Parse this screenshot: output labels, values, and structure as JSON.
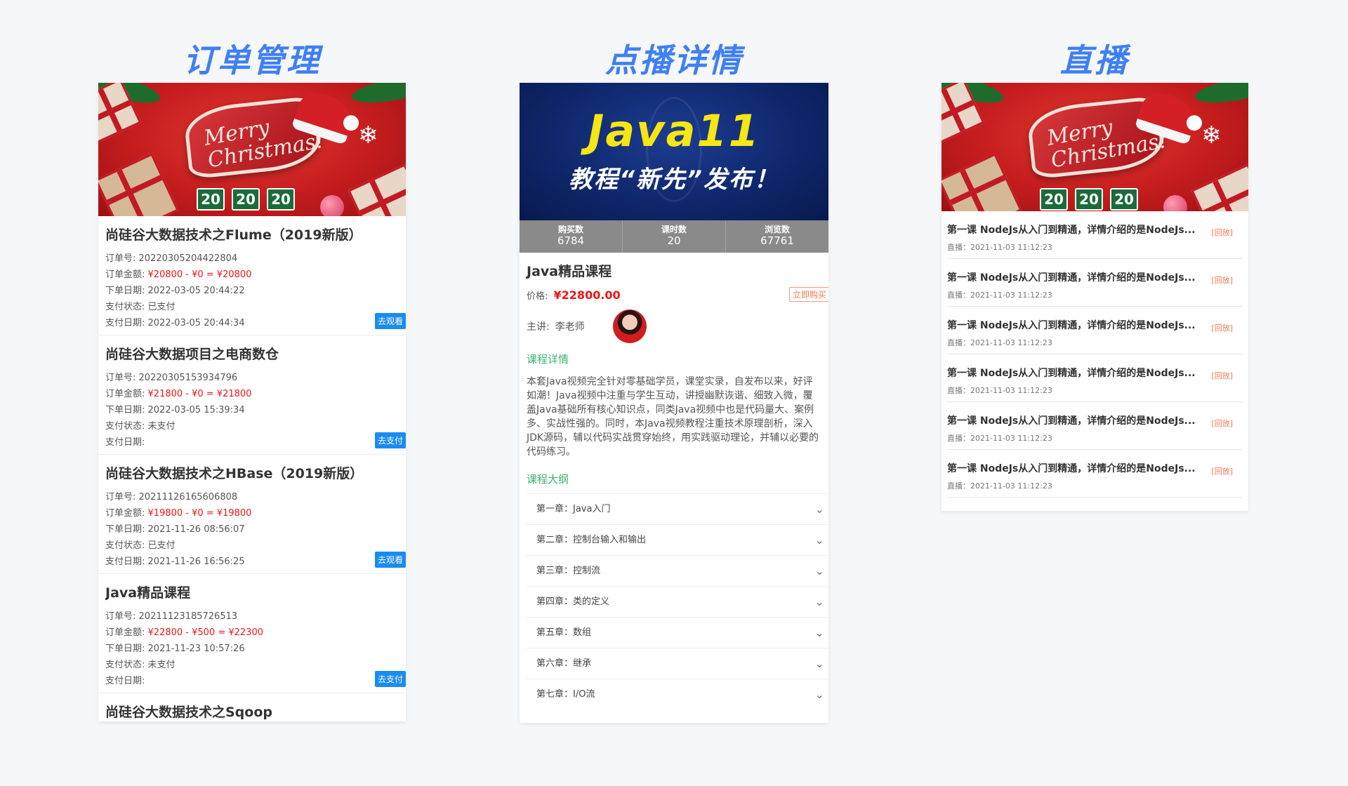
{
  "sections": {
    "orders": "订单管理",
    "vod": "点播详情",
    "live": "直播"
  },
  "banner": {
    "text_line1": "Merry",
    "text_line2": "Christmas!",
    "tile": "20"
  },
  "orders": [
    {
      "title": "尚硅谷大数据技术之Flume（2019新版）",
      "order_no_label": "订单号:",
      "order_no": "20220305204422804",
      "amount_label": "订单金额:",
      "amount": "¥20800 - ¥0 = ¥20800",
      "date_label": "下单日期:",
      "date": "2022-03-05 20:44:22",
      "status_label": "支付状态:",
      "status": "已支付",
      "pay_date_label": "支付日期:",
      "pay_date": "2022-03-05 20:44:34",
      "button": "去观看"
    },
    {
      "title": "尚硅谷大数据项目之电商数仓",
      "order_no_label": "订单号:",
      "order_no": "20220305153934796",
      "amount_label": "订单金额:",
      "amount": "¥21800 - ¥0 = ¥21800",
      "date_label": "下单日期:",
      "date": "2022-03-05 15:39:34",
      "status_label": "支付状态:",
      "status": "未支付",
      "pay_date_label": "支付日期:",
      "pay_date": "",
      "button": "去支付"
    },
    {
      "title": "尚硅谷大数据技术之HBase（2019新版）",
      "order_no_label": "订单号:",
      "order_no": "20211126165606808",
      "amount_label": "订单金额:",
      "amount": "¥19800 - ¥0 = ¥19800",
      "date_label": "下单日期:",
      "date": "2021-11-26 08:56:07",
      "status_label": "支付状态:",
      "status": "已支付",
      "pay_date_label": "支付日期:",
      "pay_date": "2021-11-26 16:56:25",
      "button": "去观看"
    },
    {
      "title": "Java精品课程",
      "order_no_label": "订单号:",
      "order_no": "20211123185726513",
      "amount_label": "订单金额:",
      "amount": "¥22800 - ¥500 = ¥22300",
      "date_label": "下单日期:",
      "date": "2021-11-23 10:57:26",
      "status_label": "支付状态:",
      "status": "未支付",
      "pay_date_label": "支付日期:",
      "pay_date": "",
      "button": "去支付"
    }
  ],
  "orders_partial_title": "尚硅谷大数据技术之Sqoop",
  "vod": {
    "banner_title": "Java11",
    "banner_sub": "教程“新先”发布！",
    "stats": [
      {
        "label": "购买数",
        "value": "6784"
      },
      {
        "label": "课时数",
        "value": "20"
      },
      {
        "label": "浏览数",
        "value": "67761"
      }
    ],
    "course_name": "Java精品课程",
    "price_label": "价格:",
    "price": "¥22800.00",
    "buy_button": "立即购买",
    "teacher_label": "主讲:",
    "teacher_name": "李老师",
    "detail_head": "课程详情",
    "description": "本套Java视频完全针对零基础学员，课堂实录，自发布以来，好评如潮！Java视频中注重与学生互动，讲授幽默诙谐、细致入微，覆盖Java基础所有核心知识点，同类Java视频中也是代码量大、案例多、实战性强的。同时，本Java视频教程注重技术原理剖析，深入JDK源码，辅以代码实战贯穿始终，用实践驱动理论，并辅以必要的代码练习。",
    "outline_head": "课程大纲",
    "chapters": [
      "第一章：Java入门",
      "第二章：控制台输入和输出",
      "第三章：控制流",
      "第四章：类的定义",
      "第五章：数组",
      "第六章：继承",
      "第七章：I/O流"
    ]
  },
  "live": {
    "items": [
      {
        "title": "第一课 NodeJs从入门到精通，详情介绍的是NodeJs...",
        "time": "直播：2021-11-03 11:12:23",
        "tag": "[回放]"
      },
      {
        "title": "第一课 NodeJs从入门到精通，详情介绍的是NodeJs...",
        "time": "直播：2021-11-03 11:12:23",
        "tag": "[回放]"
      },
      {
        "title": "第一课 NodeJs从入门到精通，详情介绍的是NodeJs...",
        "time": "直播：2021-11-03 11:12:23",
        "tag": "[回放]"
      },
      {
        "title": "第一课 NodeJs从入门到精通，详情介绍的是NodeJs...",
        "time": "直播：2021-11-03 11:12:23",
        "tag": "[回放]"
      },
      {
        "title": "第一课 NodeJs从入门到精通，详情介绍的是NodeJs...",
        "time": "直播：2021-11-03 11:12:23",
        "tag": "[回放]"
      },
      {
        "title": "第一课 NodeJs从入门到精通，详情介绍的是NodeJs...",
        "time": "直播：2021-11-03 11:12:23",
        "tag": "[回放]"
      }
    ]
  }
}
